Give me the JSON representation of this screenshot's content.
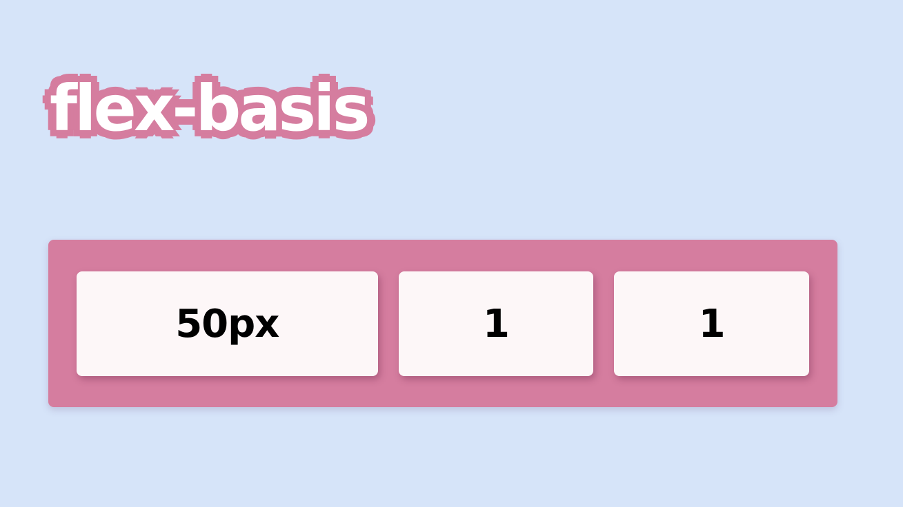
{
  "title": "flex-basis",
  "items": [
    {
      "label": "50px"
    },
    {
      "label": "1"
    },
    {
      "label": "1"
    }
  ],
  "colors": {
    "background": "#d6e4f9",
    "accent": "#d57d9f",
    "item_background": "#fdf7f8",
    "title_text": "#ffffff",
    "item_text": "#000000"
  }
}
